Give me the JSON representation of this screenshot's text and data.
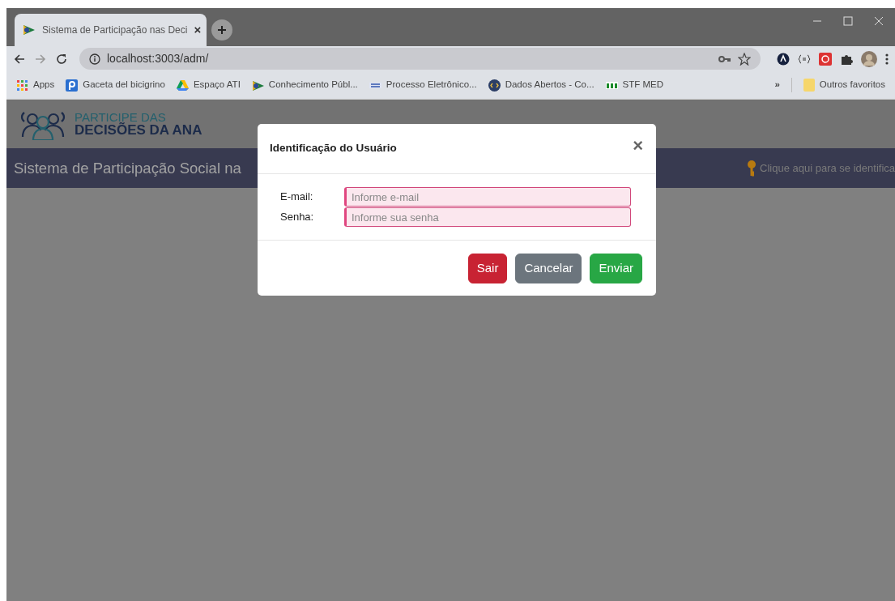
{
  "browser": {
    "tab": {
      "title": "Sistema de Participação nas Deci",
      "close": "×",
      "selected": true
    },
    "address": "localhost:3003/adm/",
    "bookmarks": [
      {
        "label": "Apps"
      },
      {
        "label": "Gaceta del bicigrino"
      },
      {
        "label": "Espaço ATI"
      },
      {
        "label": "Conhecimento Públ..."
      },
      {
        "label": "Processo Eletrônico..."
      },
      {
        "label": "Dados Abertos - Co..."
      },
      {
        "label": "STF MED"
      }
    ],
    "more": "»",
    "other_bookmarks": "Outros favoritos"
  },
  "header": {
    "logo_line1": "PARTICIPE DAS",
    "logo_line2": "DECISÕES DA ANA"
  },
  "navbar": {
    "title": "Sistema de Participação Social na",
    "login_link": "Clique aqui para se identifica"
  },
  "modal": {
    "title": "Identificação do Usuário",
    "close": "×",
    "fields": [
      {
        "label": "E-mail:",
        "placeholder": "Informe e-mail",
        "invalid": true
      },
      {
        "label": "Senha:",
        "placeholder": "Informe sua senha",
        "invalid": true
      }
    ],
    "buttons": [
      {
        "label": "Sair",
        "kind": "danger"
      },
      {
        "label": "Cancelar",
        "kind": "secondary"
      },
      {
        "label": "Enviar",
        "kind": "success"
      }
    ]
  }
}
